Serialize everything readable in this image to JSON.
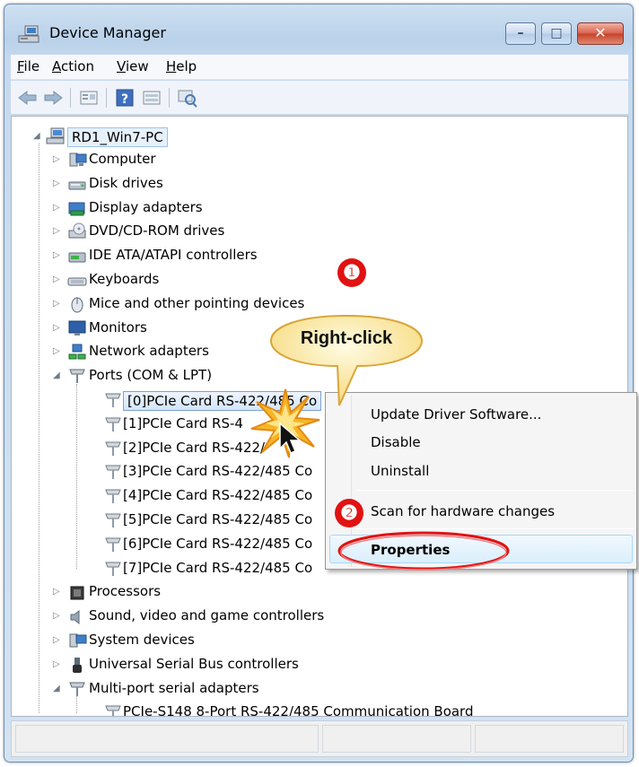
{
  "window": {
    "title": "Device Manager"
  },
  "title_controls": {
    "minimize": "–",
    "maximize": "□",
    "close": "✕"
  },
  "menu": [
    {
      "label": "File",
      "accel": "F",
      "rest": "ile"
    },
    {
      "label": "Action",
      "accel": "A",
      "rest": "ction"
    },
    {
      "label": "View",
      "accel": "V",
      "rest": "iew"
    },
    {
      "label": "Help",
      "accel": "H",
      "rest": "elp"
    }
  ],
  "toolbar": [
    "back-arrow-icon",
    "forward-arrow-icon",
    "properties-sheet-icon",
    "help-icon",
    "view-icon",
    "scan-hardware-icon"
  ],
  "tree": {
    "root": "RD1_Win7-PC",
    "categories": [
      {
        "label": "Computer",
        "icon": "computer-icon",
        "expanded": false
      },
      {
        "label": "Disk drives",
        "icon": "disk-drive-icon",
        "expanded": false
      },
      {
        "label": "Display adapters",
        "icon": "display-adapter-icon",
        "expanded": false
      },
      {
        "label": "DVD/CD-ROM drives",
        "icon": "dvd-drive-icon",
        "expanded": false
      },
      {
        "label": "IDE ATA/ATAPI controllers",
        "icon": "ide-controller-icon",
        "expanded": false
      },
      {
        "label": "Keyboards",
        "icon": "keyboard-icon",
        "expanded": false
      },
      {
        "label": "Mice and other pointing devices",
        "icon": "mouse-icon",
        "expanded": false
      },
      {
        "label": "Monitors",
        "icon": "monitor-icon",
        "expanded": false
      },
      {
        "label": "Network adapters",
        "icon": "network-adapter-icon",
        "expanded": false
      },
      {
        "label": "Ports (COM & LPT)",
        "icon": "port-icon",
        "expanded": true
      }
    ],
    "ports": [
      "[0]PCIe Card RS-422/485 Co",
      "[1]PCIe Card RS-4",
      "[2]PCIe Card RS-422/",
      "[3]PCIe Card RS-422/485 Co",
      "[4]PCIe Card RS-422/485 Co",
      "[5]PCIe Card RS-422/485 Co",
      "[6]PCIe Card RS-422/485 Co",
      "[7]PCIe Card RS-422/485 Co"
    ],
    "categories_after": [
      {
        "label": "Processors",
        "icon": "processor-icon",
        "expanded": false
      },
      {
        "label": "Sound, video and game controllers",
        "icon": "sound-icon",
        "expanded": false
      },
      {
        "label": "System devices",
        "icon": "system-device-icon",
        "expanded": false
      },
      {
        "label": "Universal Serial Bus controllers",
        "icon": "usb-icon",
        "expanded": false
      },
      {
        "label": "Multi-port serial adapters",
        "icon": "port-icon",
        "expanded": true
      }
    ],
    "multiport_child": "PCIe-S148 8-Port RS-422/485 Communication Board"
  },
  "context_menu": {
    "items": [
      "Update Driver Software...",
      "Disable",
      "Uninstall",
      "Scan for hardware changes",
      "Properties"
    ],
    "highlighted": "Properties"
  },
  "annotations": {
    "callout": "Right-click",
    "step1": "❶",
    "step2": "❷",
    "accent_red": "#e11212"
  }
}
